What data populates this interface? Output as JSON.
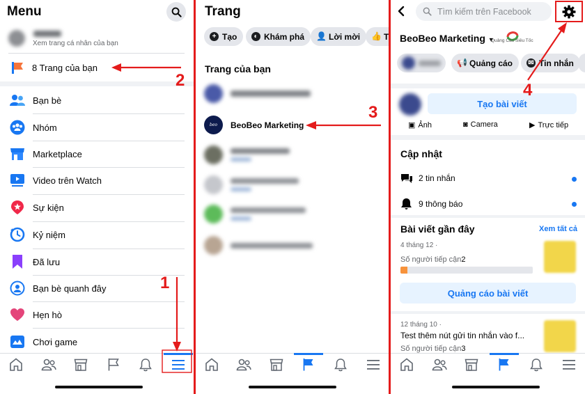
{
  "panel1": {
    "title": "Menu",
    "profile_sub": "Xem trang cá nhân của bạn",
    "pages_link": "8 Trang của bạn",
    "items": [
      {
        "label": "Bạn bè"
      },
      {
        "label": "Nhóm"
      },
      {
        "label": "Marketplace"
      },
      {
        "label": "Video trên Watch"
      },
      {
        "label": "Sự kiện"
      },
      {
        "label": "Kỷ niệm"
      },
      {
        "label": "Đã lưu"
      },
      {
        "label": "Bạn bè quanh đây"
      },
      {
        "label": "Hẹn hò"
      },
      {
        "label": "Chơi game"
      }
    ],
    "step_a": "1",
    "step_b": "2"
  },
  "panel2": {
    "title": "Trang",
    "chips": [
      "Tạo",
      "Khám phá",
      "Lời mời",
      "Th"
    ],
    "section_title": "Trang của bạn",
    "main_page": "BeoBeo Marketing",
    "step": "3"
  },
  "panel3": {
    "search_placeholder": "Tìm kiếm trên Facebook",
    "page_name": "BeoBeo Marketing",
    "watermark": "Quảng Cáo Siêu Tốc",
    "actions": [
      "Quảng cáo",
      "Tin nhắn"
    ],
    "create_post": "Tạo bài viết",
    "media": [
      "Ảnh",
      "Camera",
      "Trực tiếp"
    ],
    "updates_title": "Cập nhật",
    "messages": "2 tin nhắn",
    "notifications": "9 thông báo",
    "recent_title": "Bài viết gần đây",
    "see_all": "Xem tất cả",
    "post1_date": "4 tháng 12 ·",
    "reach_label": "Số người tiếp cận",
    "post1_reach": "2",
    "reach_progress": 0.05,
    "boost_button": "Quảng cáo bài viết",
    "post2_date": "12 tháng 10 ·",
    "post2_title": "Test thêm nút gửi tin nhắn vào f...",
    "post2_reach": "3",
    "step": "4"
  },
  "colors": {
    "accent": "#1877f2",
    "annotation": "#e41b1b"
  }
}
